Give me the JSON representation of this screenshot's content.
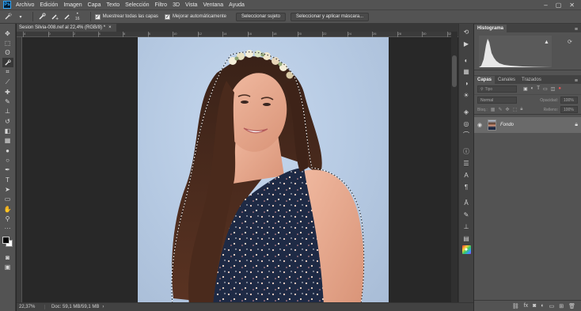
{
  "menu": {
    "app_logo": "Ps",
    "items": [
      "Archivo",
      "Edición",
      "Imagen",
      "Capa",
      "Texto",
      "Selección",
      "Filtro",
      "3D",
      "Vista",
      "Ventana",
      "Ayuda"
    ],
    "window_controls": [
      "–",
      "▢",
      "✕"
    ]
  },
  "options": {
    "brush_size": "16",
    "sample_all_layers_label": "Muestrear todas las capas",
    "auto_enhance_label": "Mejorar automáticamente",
    "select_subject_label": "Seleccionar sujeto",
    "select_mask_label": "Seleccionar y aplicar máscara..."
  },
  "document": {
    "tab_title": "Sesion Silvia-008.nef al 22,4% (RGB/8) *",
    "ruler_top_labels": [
      "4",
      "0",
      "2",
      "4",
      "6",
      "8",
      "10",
      "12",
      "14",
      "16",
      "18",
      "20",
      "22",
      "24",
      "26",
      "28",
      "30",
      "32"
    ],
    "zoom": "22,37%",
    "doc_info": "Doc: 59,1 MB/59,1 MB"
  },
  "panels": {
    "histogram_tab": "Histograma",
    "histogram_warning_icon": "warning-icon",
    "layers_tabs": [
      "Capas",
      "Canales",
      "Trazados"
    ],
    "filter_placeholder": "Tipo",
    "blend_mode": "Normal",
    "opacity_label": "Opacidad:",
    "opacity_value": "100%",
    "lock_label": "Bloq.:",
    "fill_label": "Relleno:",
    "fill_value": "100%",
    "layer_name": "Fondo"
  },
  "colors": {
    "accent": "#31a8ff",
    "ui_panel": "#535353",
    "ui_dark": "#282828"
  }
}
